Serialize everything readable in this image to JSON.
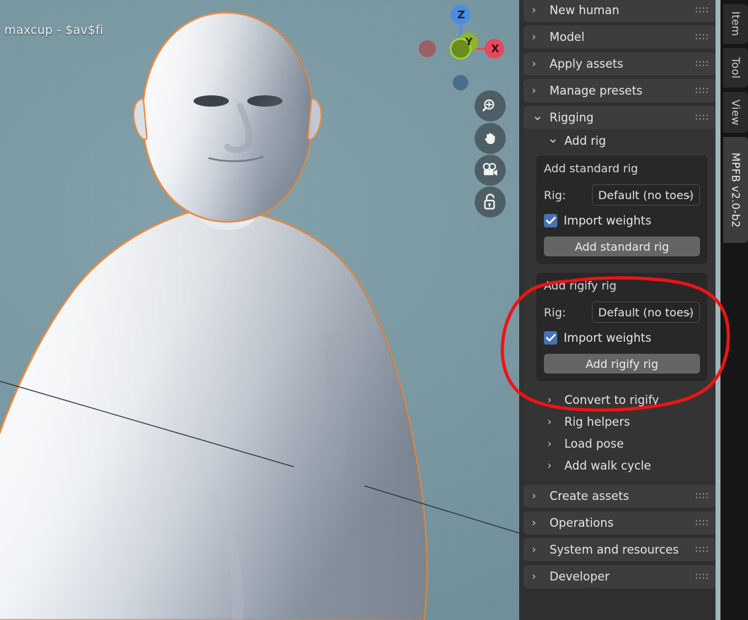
{
  "viewport": {
    "overlay_text": "- maxcup - $av$fi",
    "background_color": "#7b9aa4",
    "selection_outline_color": "#f0893a",
    "model_name": "human-body-model"
  },
  "gizmo": {
    "axes": [
      {
        "label": "Z",
        "color": "#4a8ee0",
        "name": "z-axis"
      },
      {
        "label": "X",
        "color": "#e4495c",
        "name": "x-axis"
      },
      {
        "label": "Y",
        "color": "#7aa82a",
        "name": "y-axis"
      },
      {
        "label": "",
        "color": "#9c5f64",
        "name": "neg-x-axis"
      },
      {
        "label": "",
        "color": "#4a6f8e",
        "name": "neg-z-axis"
      }
    ]
  },
  "viewport_tools": [
    {
      "name": "zoom-tool",
      "icon": "magnifier-plus-icon"
    },
    {
      "name": "pan-tool",
      "icon": "hand-icon"
    },
    {
      "name": "camera-tool",
      "icon": "camera-icon"
    },
    {
      "name": "lock-tool",
      "icon": "padlock-icon"
    }
  ],
  "tabs": [
    {
      "label": "Item",
      "active": false
    },
    {
      "label": "Tool",
      "active": false
    },
    {
      "label": "View",
      "active": false
    },
    {
      "label": "MPFB v2.0-b2",
      "active": true
    }
  ],
  "panels": [
    {
      "label": "New human",
      "expanded": false
    },
    {
      "label": "Model",
      "expanded": false
    },
    {
      "label": "Apply assets",
      "expanded": false
    },
    {
      "label": "Manage presets",
      "expanded": false
    },
    {
      "label": "Rigging",
      "expanded": true
    }
  ],
  "rigging": {
    "subsection_label": "Add rig",
    "standard_rig": {
      "title": "Add standard rig",
      "rig_label": "Rig:",
      "rig_value": "Default (no toes)",
      "import_weights_label": "Import weights",
      "import_weights_checked": true,
      "button_label": "Add standard rig"
    },
    "rigify_rig": {
      "title": "Add rigify rig",
      "rig_label": "Rig:",
      "rig_value": "Default (no toes)",
      "import_weights_label": "Import weights",
      "import_weights_checked": true,
      "button_label": "Add rigify rig"
    },
    "sub_items": [
      {
        "label": "Convert to rigify"
      },
      {
        "label": "Rig helpers"
      },
      {
        "label": "Load pose"
      },
      {
        "label": "Add walk cycle"
      }
    ]
  },
  "bottom_panels": [
    {
      "label": "Create assets",
      "expanded": false
    },
    {
      "label": "Operations",
      "expanded": false
    },
    {
      "label": "System and resources",
      "expanded": false
    },
    {
      "label": "Developer",
      "expanded": false
    }
  ],
  "annotation": {
    "shape": "hand-drawn-ellipse",
    "color": "#ee1414",
    "target": "Add rigify rig"
  },
  "icons": {
    "chevron_right": "›",
    "chevron_down": "⌄"
  }
}
